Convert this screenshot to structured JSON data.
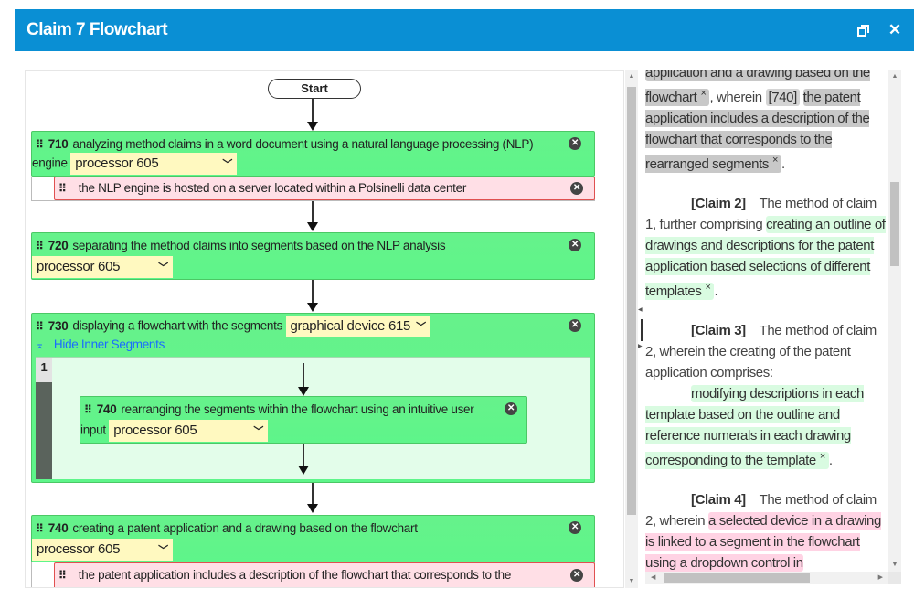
{
  "window": {
    "title": "Claim 7 Flowchart",
    "restore_icon": "restore-window-icon",
    "close_icon": "close-icon",
    "close_glyph": "✕",
    "accent_color": "#0a8fd4"
  },
  "flowchart": {
    "start_label": "Start",
    "grip_glyph": "⠿",
    "remove_glyph": "✕",
    "chevron_glyph": "⌄",
    "segments": [
      {
        "number": "710",
        "text_line1": "analyzing method claims in a word document using a natural language processing (NLP)",
        "text_line2": "engine",
        "device": "processor 605",
        "sub": {
          "text": "the NLP engine is hosted on a server located within a Polsinelli data center"
        }
      },
      {
        "number": "720",
        "text_line1": "separating the method claims into segments based on the NLP analysis",
        "device": "processor 605"
      },
      {
        "number": "730",
        "text_line1": "displaying a flowchart with the segments",
        "device": "graphical device 615",
        "toggle_label": "Hide Inner Segments",
        "toggle_glyph": "⌃",
        "inner_index": "1",
        "inner": {
          "number": "740",
          "text_line1": "rearranging the segments within the flowchart using an intuitive user",
          "text_line2": "input",
          "device": "processor 605"
        }
      },
      {
        "number": "740",
        "text_line1": "creating a patent application and a drawing based on the flowchart",
        "device": "processor 605",
        "sub": {
          "text": "the patent application includes a description of the flowchart that corresponds to the"
        }
      }
    ]
  },
  "document": {
    "p0": {
      "hl1": "application and a drawing based on the flowchart",
      "mid": ", wherein ",
      "ref": "[740]",
      "hl2": "the patent application includes a description of the flowchart that corresponds to the rearranged segments",
      "end": "."
    },
    "p1": {
      "label": "[Claim 2]",
      "lead": "The method of claim 1, further comprising ",
      "hl": "creating an outline of drawings and descriptions for the patent application based selections of different templates",
      "end": "."
    },
    "p2": {
      "label": "[Claim 3]",
      "lead": "The method of claim 2, wherein the creating of the patent application comprises:",
      "hl": "modifying descriptions in each template based on the outline and reference numerals in each drawing corresponding to the template",
      "end": "."
    },
    "p3": {
      "label": "[Claim 4]",
      "lead": "The method of claim 2, wherein ",
      "hl": "a selected device in a drawing is linked to a segment in the flowchart using a dropdown control in"
    },
    "remove_glyph": "×",
    "highlight_colors": {
      "gray": "#c8c8c8",
      "green": "#d9fbe1",
      "pink": "#ffd3e4"
    }
  }
}
